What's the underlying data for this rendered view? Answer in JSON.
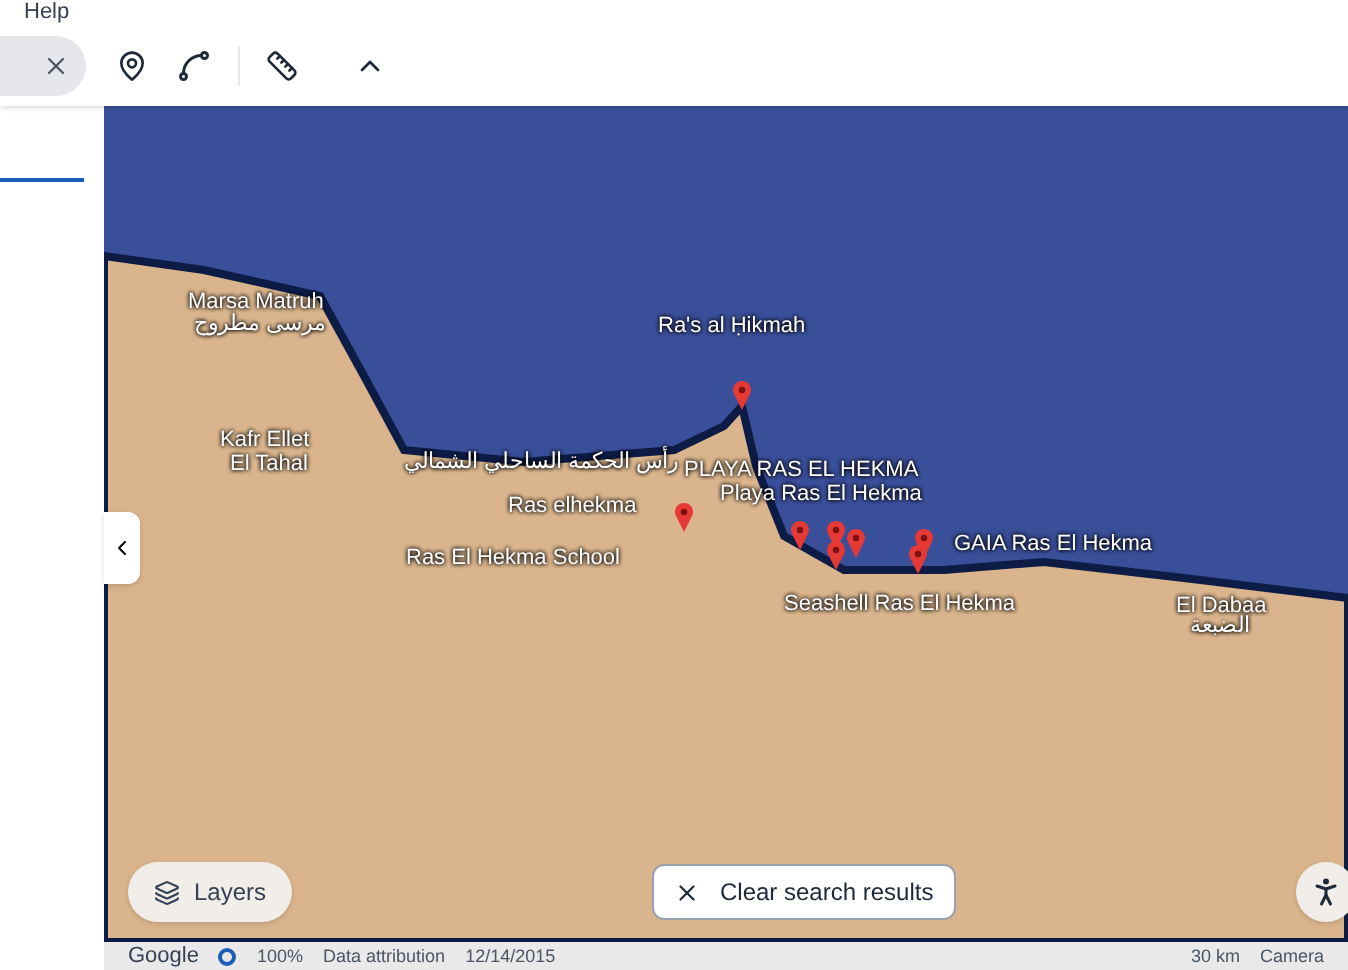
{
  "menu": {
    "items": [
      "Help"
    ]
  },
  "map": {
    "labels": [
      {
        "text": "Marsa Matruh",
        "kind": "place"
      },
      {
        "text": "مرسى مطروح",
        "kind": "place"
      },
      {
        "text": "Ra's al Ḥikmah",
        "kind": "place"
      },
      {
        "text": "Kafr Ellet",
        "kind": "place"
      },
      {
        "text": "El Tahal",
        "kind": "place"
      },
      {
        "text": "رأس الحكمة الساحلي الشمالي",
        "kind": "place"
      },
      {
        "text": "PLAYA RAS EL HEKMA",
        "kind": "place"
      },
      {
        "text": "Playa Ras El Hekma",
        "kind": "place"
      },
      {
        "text": "Ras elhekma",
        "kind": "place"
      },
      {
        "text": "GAIA Ras El Hekma",
        "kind": "place"
      },
      {
        "text": "Ras El Hekma School",
        "kind": "place"
      },
      {
        "text": "Seashell Ras El Hekma",
        "kind": "place"
      },
      {
        "text": "El Dabaa",
        "kind": "place"
      },
      {
        "text": "الضبعة",
        "kind": "place"
      }
    ],
    "layers_button": "Layers",
    "clear_button": "Clear search results"
  },
  "status_bar": {
    "logo": "Google",
    "zoom": "100%",
    "attribution": "Data attribution",
    "date": "12/14/2015",
    "scale": "30 km",
    "camera": "Camera"
  }
}
